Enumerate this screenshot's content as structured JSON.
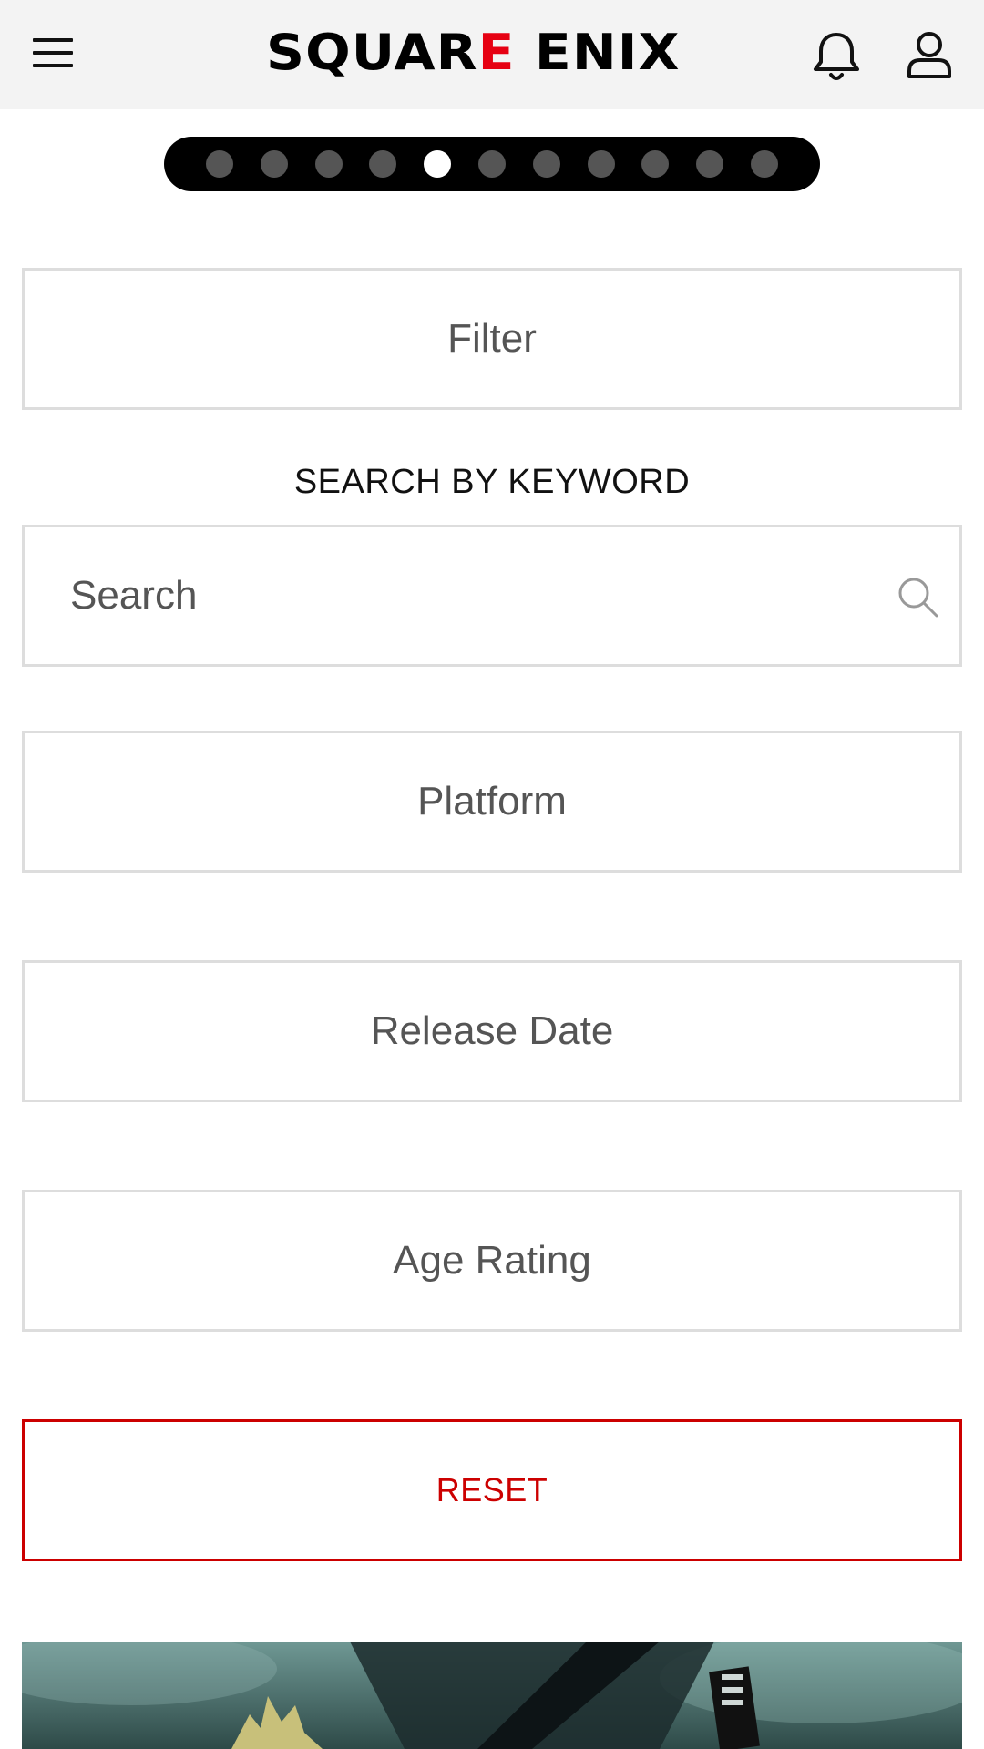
{
  "header": {
    "logo": {
      "part1": "SQUAR",
      "accent": "E",
      "part2": " ENIX"
    },
    "icons": [
      "hamburger-icon",
      "bell-icon",
      "user-icon"
    ]
  },
  "carousel": {
    "total_slides": 11,
    "active_index": 4
  },
  "filters": {
    "filter_label": "Filter",
    "keyword_label": "SEARCH BY KEYWORD",
    "search_placeholder": "Search",
    "platform_label": "Platform",
    "release_date_label": "Release Date",
    "age_rating_label": "Age Rating",
    "reset_label": "RESET"
  },
  "colors": {
    "header_bg": "#f3f3f3",
    "accent_red": "#e60012",
    "reset_red": "#cc0000",
    "border_gray": "#dddddd"
  }
}
